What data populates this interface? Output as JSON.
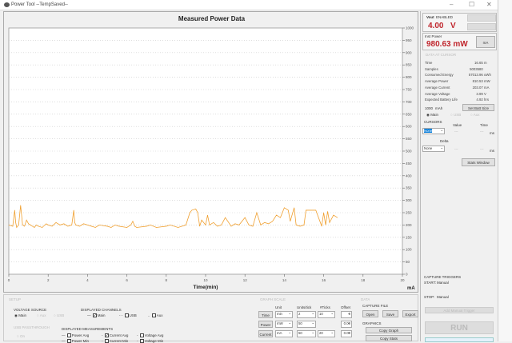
{
  "window": {
    "title": "Power Tool --TempSaved--",
    "min": "–",
    "max": "☐",
    "close": "✕"
  },
  "chart_data": {
    "type": "line",
    "title": "Measured Power Data",
    "xlabel": "Time(min)",
    "ylabel": "mA",
    "xlim": [
      0,
      20
    ],
    "ylim": [
      0,
      1000
    ],
    "xticks": [
      "0",
      "2",
      "4",
      "6",
      "8",
      "10",
      "12",
      "14",
      "16",
      "18",
      "20"
    ],
    "yticks": [
      "0",
      "50",
      "100",
      "150",
      "200",
      "250",
      "300",
      "350",
      "400",
      "450",
      "500",
      "550",
      "600",
      "650",
      "700",
      "750",
      "800",
      "850",
      "900",
      "950",
      "1000"
    ],
    "grid": true,
    "series": [
      {
        "name": "Main",
        "color": "#f0a030",
        "x": [
          0,
          0.2,
          0.3,
          0.35,
          0.4,
          0.5,
          0.6,
          0.7,
          0.8,
          0.9,
          1.0,
          1.1,
          1.2,
          1.3,
          1.4,
          1.5,
          1.7,
          1.9,
          2.0,
          2.2,
          2.4,
          2.6,
          2.8,
          3.0,
          3.2,
          3.3,
          3.35,
          3.4,
          3.6,
          3.8,
          4.0,
          4.2,
          4.4,
          4.6,
          5.0,
          5.2,
          5.4,
          5.6,
          6.0,
          6.2,
          6.3,
          6.4,
          6.5,
          7.0,
          7.2,
          7.5,
          8.0,
          8.2,
          8.6,
          9.0,
          9.2,
          9.3,
          9.5,
          9.6,
          9.7,
          9.8,
          10.0,
          10.1,
          10.2,
          10.4,
          10.6,
          10.8,
          11.0,
          11.3,
          11.5,
          11.7,
          12.0,
          12.2,
          12.4,
          12.6,
          12.8,
          13.0,
          13.2,
          13.4,
          13.6,
          13.8,
          14.0,
          14.2,
          14.3,
          14.5,
          14.6,
          14.8,
          15.0,
          15.1,
          15.3,
          15.6,
          15.9,
          16.0,
          16.1,
          16.2,
          16.3,
          16.5,
          16.7
        ],
        "y": [
          200,
          195,
          260,
          210,
          190,
          200,
          280,
          200,
          195,
          220,
          205,
          200,
          195,
          190,
          200,
          195,
          190,
          205,
          200,
          195,
          210,
          200,
          205,
          195,
          200,
          260,
          210,
          200,
          195,
          205,
          200,
          195,
          190,
          200,
          195,
          190,
          200,
          195,
          190,
          200,
          215,
          195,
          190,
          195,
          200,
          190,
          195,
          200,
          190,
          200,
          250,
          260,
          265,
          250,
          195,
          220,
          200,
          240,
          200,
          210,
          195,
          200,
          230,
          195,
          205,
          200,
          230,
          200,
          195,
          250,
          200,
          210,
          205,
          215,
          240,
          230,
          270,
          260,
          215,
          270,
          200,
          195,
          200,
          260,
          260,
          260,
          195,
          250,
          200,
          255,
          210,
          240,
          230
        ]
      }
    ]
  },
  "right": {
    "vout_label": "Vout",
    "vout_state": "ENABLED",
    "vout_value": "4.00",
    "vout_unit": "V",
    "inst_label": "Inst Power",
    "inst_value": "980.63 mW",
    "unit_btn": "mA",
    "cursor_data": "DATA AT CURSOR",
    "stats": [
      {
        "k": "Time",
        "v": "16.65",
        "u": "m"
      },
      {
        "k": "Samples",
        "v": "5003580",
        "u": ""
      },
      {
        "k": "Consumed Energy",
        "v": "57013.96",
        "u": "uWh"
      },
      {
        "k": "Average Power",
        "v": "810.53",
        "u": "mW"
      },
      {
        "k": "Average Current",
        "v": "203.07",
        "u": "mA"
      },
      {
        "k": "Average Voltage",
        "v": "3.99",
        "u": "V"
      },
      {
        "k": "Expected Battery Life",
        "v": "4.92",
        "u": "hrs"
      }
    ],
    "batt": "1000",
    "batt_unit": "mAh",
    "set_batt": "Set Batt Size",
    "radios": [
      "Main",
      "USB",
      "Aux"
    ],
    "cursors": "CURSORS",
    "value": "Value",
    "time": "Time",
    "cursor_sel": "None",
    "ms": "ms",
    "dash": "---",
    "delta": "Delta",
    "delta_sel": "None",
    "stats_window": "Stats Window",
    "triggers": "CAPTURE TRIGGERS",
    "start": "START:",
    "start_v": "Manual",
    "stop": "STOP:",
    "stop_v": "Manual",
    "trig_btn": "Add Manual Trigger",
    "run": "RUN"
  },
  "bottom": {
    "setup": "SETUP",
    "voltage_source": "VOLTAGE SOURCE",
    "vs": [
      "Main",
      "Aux",
      "USB"
    ],
    "displayed_channels": "DISPLAYED CHANNELS",
    "ch": [
      "Main",
      "USB",
      "Aux"
    ],
    "usb_passthrough": "USB PASSTHROUGH",
    "usb_on": "On",
    "displayed_measurements": "DISPLAYED MEASUREMENTS",
    "meas": [
      "Power Avg",
      "Current Avg",
      "Voltage Avg",
      "Power Min",
      "Current Min",
      "Voltage Min"
    ],
    "graph_scale": "GRAPH SCALE",
    "gs_head": [
      "Unit",
      "Units/tick",
      "#Ticks",
      "Offset"
    ],
    "gs": [
      {
        "n": "Time",
        "u": "min",
        "t": "2",
        "k": "10",
        "o": "0"
      },
      {
        "n": "Power",
        "u": "mW",
        "t": "50",
        "k": "",
        "o": "0.00"
      },
      {
        "n": "Current",
        "u": "mA",
        "t": "50",
        "k": "20",
        "o": "0.00"
      }
    ],
    "data": "DATA",
    "capture_file": "CAPTURE FILE",
    "open": "Open",
    "save": "Save",
    "export": "Export",
    "graphics": "GRAPHICS",
    "copy_graph": "Copy Graph",
    "copy_stats": "Copy Stats"
  }
}
